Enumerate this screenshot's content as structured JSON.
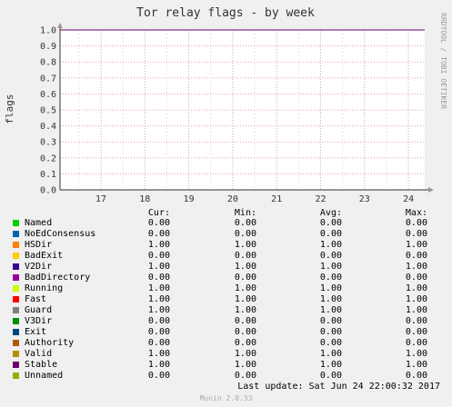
{
  "chart_data": {
    "type": "line",
    "title": "Tor relay flags - by week",
    "ylabel": "flags",
    "side_label": "RRDTOOL / TOBI OETIKER",
    "x_categories": [
      "17",
      "18",
      "19",
      "20",
      "21",
      "22",
      "23",
      "24"
    ],
    "y_ticks": [
      "0.0",
      "0.1",
      "0.2",
      "0.3",
      "0.4",
      "0.5",
      "0.6",
      "0.7",
      "0.8",
      "0.9",
      "1.0"
    ],
    "ylim": [
      0,
      1
    ],
    "grid": true,
    "series": [
      {
        "name": "Named",
        "color": "#00cc00",
        "cur": "0.00",
        "min": "0.00",
        "avg": "0.00",
        "max": "0.00",
        "value": 0
      },
      {
        "name": "NoEdConsensus",
        "color": "#0066b3",
        "cur": "0.00",
        "min": "0.00",
        "avg": "0.00",
        "max": "0.00",
        "value": 0
      },
      {
        "name": "HSDir",
        "color": "#ff8000",
        "cur": "1.00",
        "min": "1.00",
        "avg": "1.00",
        "max": "1.00",
        "value": 1
      },
      {
        "name": "BadExit",
        "color": "#ffcc00",
        "cur": "0.00",
        "min": "0.00",
        "avg": "0.00",
        "max": "0.00",
        "value": 0
      },
      {
        "name": "V2Dir",
        "color": "#330099",
        "cur": "1.00",
        "min": "1.00",
        "avg": "1.00",
        "max": "1.00",
        "value": 1
      },
      {
        "name": "BadDirectory",
        "color": "#990099",
        "cur": "0.00",
        "min": "0.00",
        "avg": "0.00",
        "max": "0.00",
        "value": 0
      },
      {
        "name": "Running",
        "color": "#ccff00",
        "cur": "1.00",
        "min": "1.00",
        "avg": "1.00",
        "max": "1.00",
        "value": 1
      },
      {
        "name": "Fast",
        "color": "#ff0000",
        "cur": "1.00",
        "min": "1.00",
        "avg": "1.00",
        "max": "1.00",
        "value": 1
      },
      {
        "name": "Guard",
        "color": "#808080",
        "cur": "1.00",
        "min": "1.00",
        "avg": "1.00",
        "max": "1.00",
        "value": 1
      },
      {
        "name": "V3Dir",
        "color": "#008f00",
        "cur": "0.00",
        "min": "0.00",
        "avg": "0.00",
        "max": "0.00",
        "value": 0
      },
      {
        "name": "Exit",
        "color": "#00487d",
        "cur": "0.00",
        "min": "0.00",
        "avg": "0.00",
        "max": "0.00",
        "value": 0
      },
      {
        "name": "Authority",
        "color": "#b35a00",
        "cur": "0.00",
        "min": "0.00",
        "avg": "0.00",
        "max": "0.00",
        "value": 0
      },
      {
        "name": "Valid",
        "color": "#b38f00",
        "cur": "1.00",
        "min": "1.00",
        "avg": "1.00",
        "max": "1.00",
        "value": 1
      },
      {
        "name": "Stable",
        "color": "#6b006b",
        "cur": "1.00",
        "min": "1.00",
        "avg": "1.00",
        "max": "1.00",
        "value": 1
      },
      {
        "name": "Unnamed",
        "color": "#8fb300",
        "cur": "0.00",
        "min": "0.00",
        "avg": "0.00",
        "max": "0.00",
        "value": 0
      }
    ]
  },
  "legend_headers": {
    "cur": "Cur:",
    "min": "Min:",
    "avg": "Avg:",
    "max": "Max:"
  },
  "footer": {
    "last_update": "Last update: Sat Jun 24 22:00:32 2017",
    "version": "Munin 2.0.33"
  }
}
